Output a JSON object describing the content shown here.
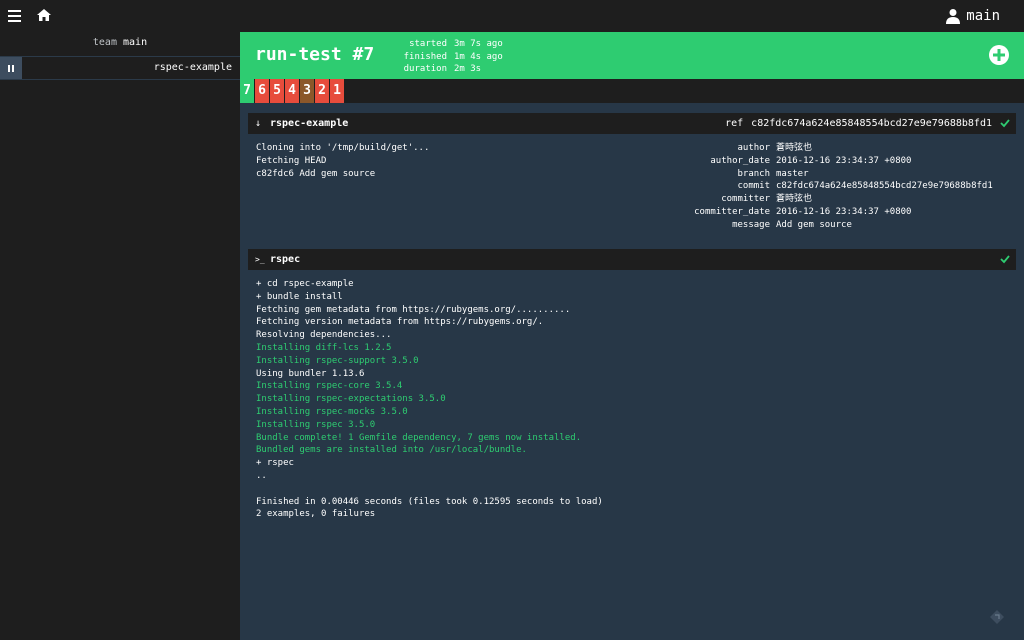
{
  "topbar": {
    "menu_icon": "hamburger-icon",
    "home_icon": "home-icon",
    "user_icon": "user-icon",
    "user_name": "main",
    "caret": "▼"
  },
  "sidebar": {
    "team_prefix": "team",
    "team_name": "main",
    "pipelines": [
      {
        "name": "rspec-example",
        "paused_icon": "pause-icon"
      }
    ]
  },
  "build": {
    "title": "run-test #7",
    "status_color": "#2ecc71",
    "times": [
      {
        "label": "started",
        "value": "3m 7s ago"
      },
      {
        "label": "finished",
        "value": "1m 4s ago"
      },
      {
        "label": "duration",
        "value": "2m 3s"
      }
    ],
    "trigger_icon": "add-circle-icon"
  },
  "builds_nav": [
    {
      "label": "7",
      "status": "succeeded",
      "color": "#2ecc71"
    },
    {
      "label": "6",
      "status": "failed",
      "color": "#e74c3c"
    },
    {
      "label": "5",
      "status": "failed",
      "color": "#e74c3c"
    },
    {
      "label": "4",
      "status": "failed",
      "color": "#e74c3c"
    },
    {
      "label": "3",
      "status": "errored",
      "color": "#8b572a"
    },
    {
      "label": "2",
      "status": "failed",
      "color": "#e74c3c"
    },
    {
      "label": "1",
      "status": "failed",
      "color": "#e74c3c"
    }
  ],
  "get_step": {
    "icon": "↓",
    "name": "rspec-example",
    "ref_label": "ref",
    "ref_value": "c82fdc674a624e85848554bcd27e9e79688b8fd1",
    "log": [
      "Cloning into '/tmp/build/get'...",
      "Fetching HEAD",
      "c82fdc6 Add gem source"
    ],
    "metadata": [
      {
        "key": "author",
        "value": "蒼時弦也"
      },
      {
        "key": "author_date",
        "value": "2016-12-16 23:34:37 +0800"
      },
      {
        "key": "branch",
        "value": "master"
      },
      {
        "key": "commit",
        "value": "c82fdc674a624e85848554bcd27e9e79688b8fd1"
      },
      {
        "key": "committer",
        "value": "蒼時弦也"
      },
      {
        "key": "committer_date",
        "value": "2016-12-16 23:34:37 +0800"
      },
      {
        "key": "message",
        "value": "Add gem source"
      }
    ]
  },
  "task_step": {
    "icon": ">_",
    "name": "rspec",
    "log": [
      {
        "text": "+ cd rspec-example",
        "green": false
      },
      {
        "text": "+ bundle install",
        "green": false
      },
      {
        "text": "Fetching gem metadata from https://rubygems.org/..........",
        "green": false
      },
      {
        "text": "Fetching version metadata from https://rubygems.org/.",
        "green": false
      },
      {
        "text": "Resolving dependencies...",
        "green": false
      },
      {
        "text": "Installing diff-lcs 1.2.5",
        "green": true
      },
      {
        "text": "Installing rspec-support 3.5.0",
        "green": true
      },
      {
        "text": "Using bundler 1.13.6",
        "green": false
      },
      {
        "text": "Installing rspec-core 3.5.4",
        "green": true
      },
      {
        "text": "Installing rspec-expectations 3.5.0",
        "green": true
      },
      {
        "text": "Installing rspec-mocks 3.5.0",
        "green": true
      },
      {
        "text": "Installing rspec 3.5.0",
        "green": true
      },
      {
        "text": "Bundle complete! 1 Gemfile dependency, 7 gems now installed.",
        "green": true
      },
      {
        "text": "Bundled gems are installed into /usr/local/bundle.",
        "green": true
      },
      {
        "text": "+ rspec",
        "green": false
      },
      {
        "text": "..",
        "green": false
      },
      {
        "text": "",
        "green": false
      },
      {
        "text": "Finished in 0.00446 seconds (files took 0.12595 seconds to load)",
        "green": false
      },
      {
        "text": "2 examples, 0 failures",
        "green": false
      }
    ]
  },
  "colors": {
    "success": "#2ecc71",
    "failed": "#e74c3c",
    "errored": "#8b572a",
    "background": "#273747",
    "bar": "#1e1e1e"
  }
}
